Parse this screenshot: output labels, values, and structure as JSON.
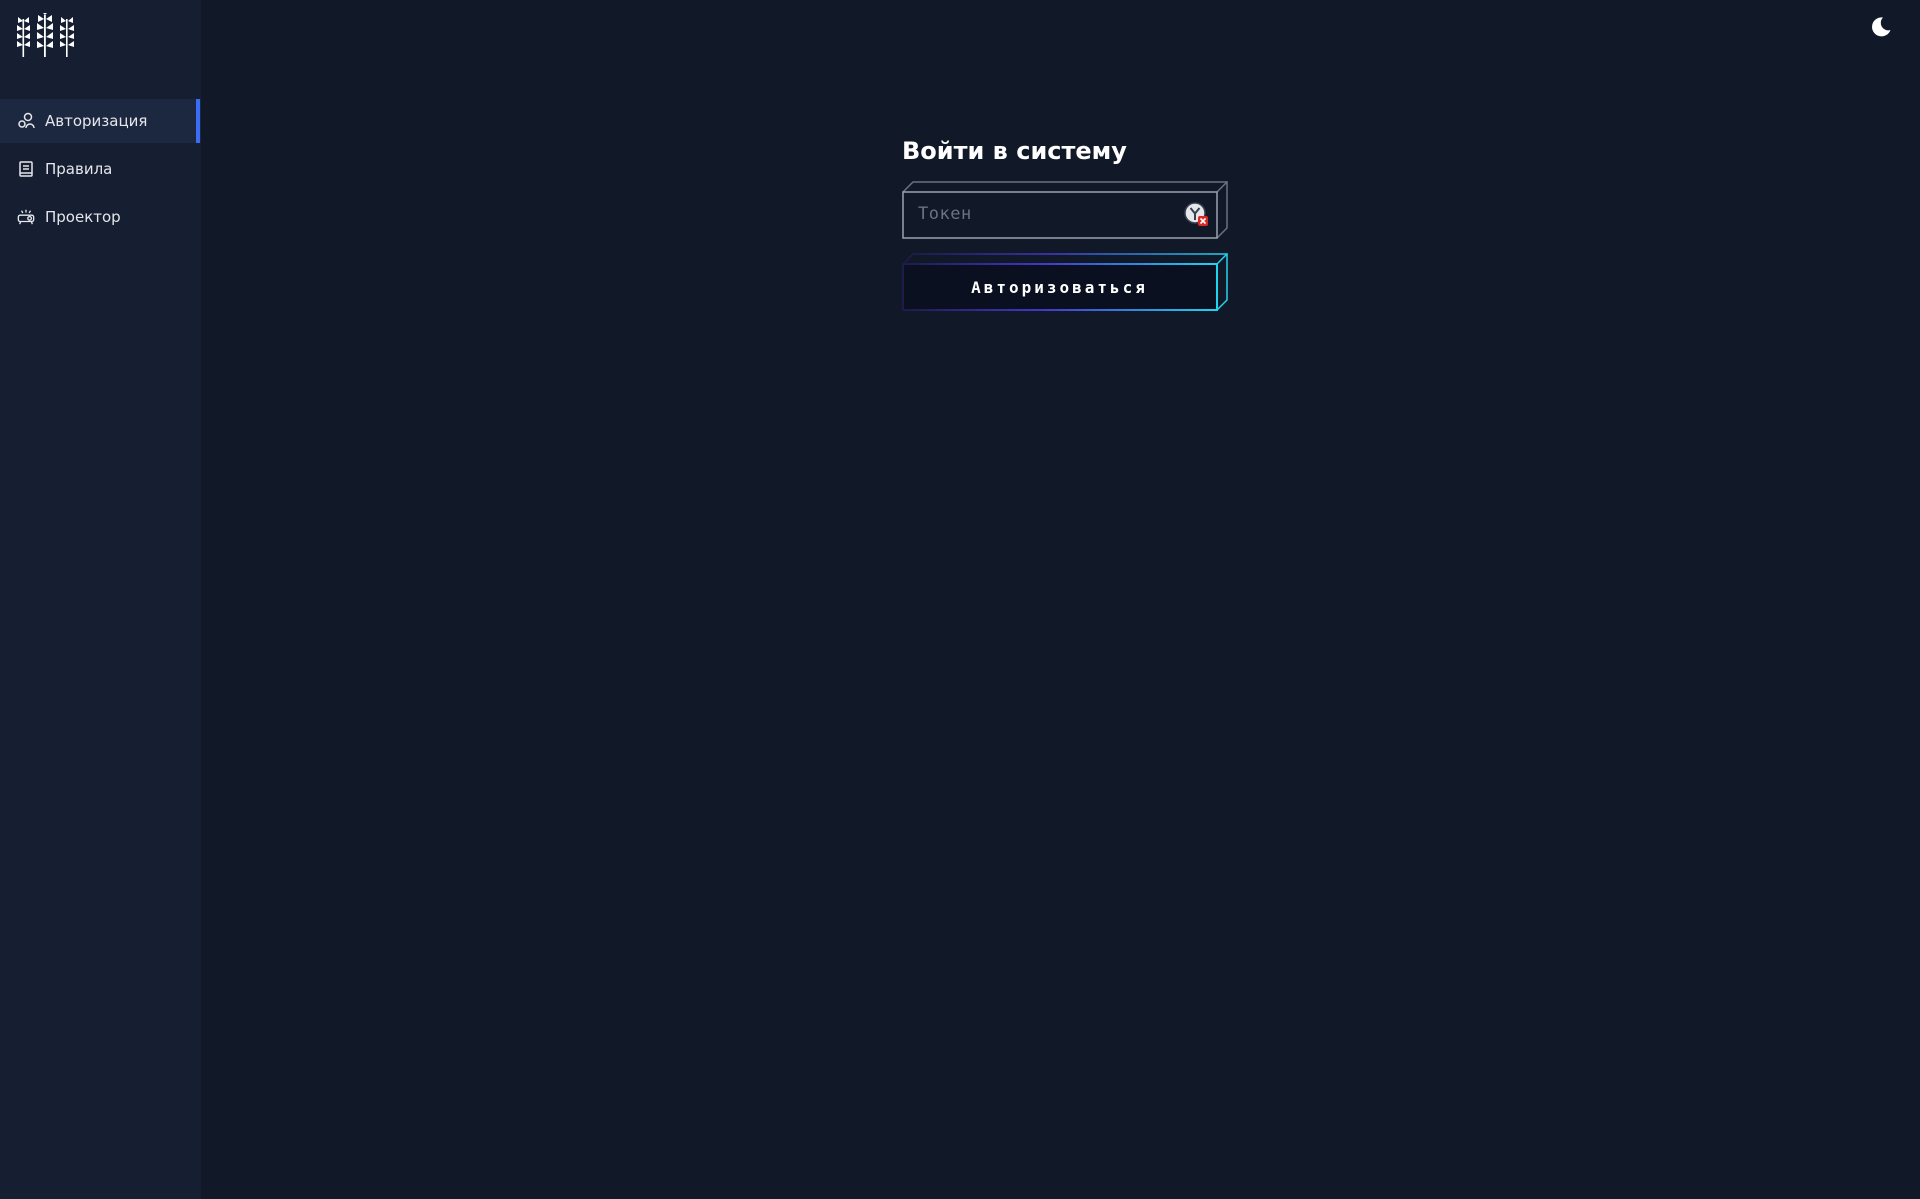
{
  "sidebar": {
    "logo_icon": "wheat-logo-icon",
    "items": [
      {
        "label": "Авторизация",
        "icon": "users-icon",
        "active": true
      },
      {
        "label": "Правила",
        "icon": "book-icon",
        "active": false
      },
      {
        "label": "Проектор",
        "icon": "projector-icon",
        "active": false
      }
    ]
  },
  "header": {
    "theme_toggle_icon": "moon-icon"
  },
  "login": {
    "title": "Войти в систему",
    "token_placeholder": "Токен",
    "token_value": "",
    "submit_label": "Авторизоваться"
  },
  "colors": {
    "background": "#111827",
    "sidebar": "#151f31",
    "active_accent": "#3b6cf5",
    "button_glow": "#22d3ee"
  }
}
